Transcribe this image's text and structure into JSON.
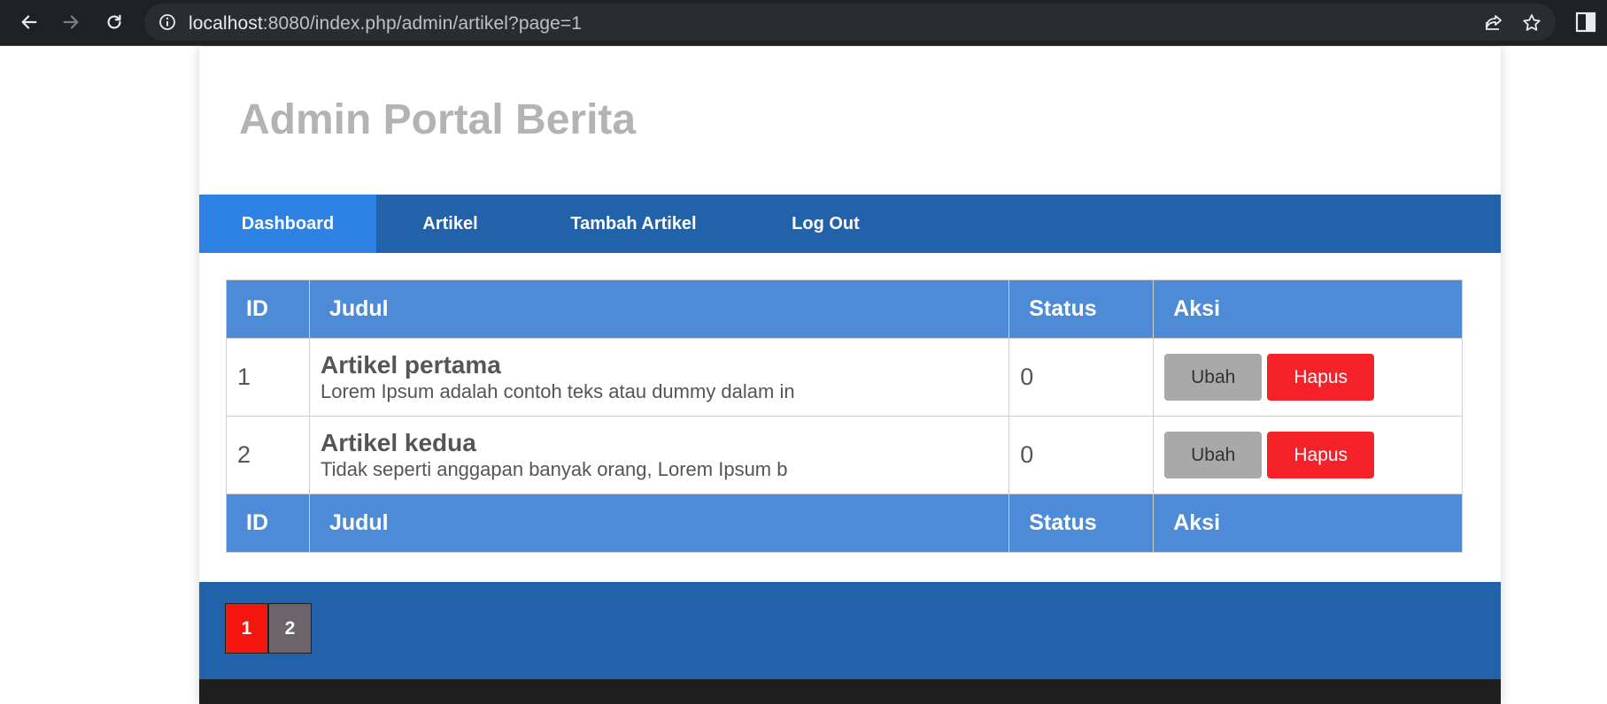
{
  "browser": {
    "url_host": "localhost",
    "url_rest": ":8080/index.php/admin/artikel?page=1"
  },
  "site": {
    "title": "Admin Portal Berita"
  },
  "nav": {
    "items": [
      {
        "label": "Dashboard",
        "active": true
      },
      {
        "label": "Artikel",
        "active": false
      },
      {
        "label": "Tambah Artikel",
        "active": false
      },
      {
        "label": "Log Out",
        "active": false
      }
    ]
  },
  "table": {
    "headers": [
      "ID",
      "Judul",
      "Status",
      "Aksi"
    ],
    "rows": [
      {
        "id": "1",
        "title": "Artikel pertama",
        "excerpt": "Lorem Ipsum adalah contoh teks atau dummy dalam in",
        "status": "0",
        "edit_label": "Ubah",
        "delete_label": "Hapus"
      },
      {
        "id": "2",
        "title": "Artikel kedua",
        "excerpt": "Tidak seperti anggapan banyak orang, Lorem Ipsum b",
        "status": "0",
        "edit_label": "Ubah",
        "delete_label": "Hapus"
      }
    ],
    "footers": [
      "ID",
      "Judul",
      "Status",
      "Aksi"
    ]
  },
  "pagination": {
    "pages": [
      "1",
      "2"
    ],
    "current": "1"
  },
  "colors": {
    "nav_bg": "#2162ab",
    "nav_active": "#2d82e4",
    "table_header": "#4d8bd6",
    "delete_button": "#f5222a",
    "edit_button": "#a9a9a9",
    "page_current": "#f5150f"
  }
}
